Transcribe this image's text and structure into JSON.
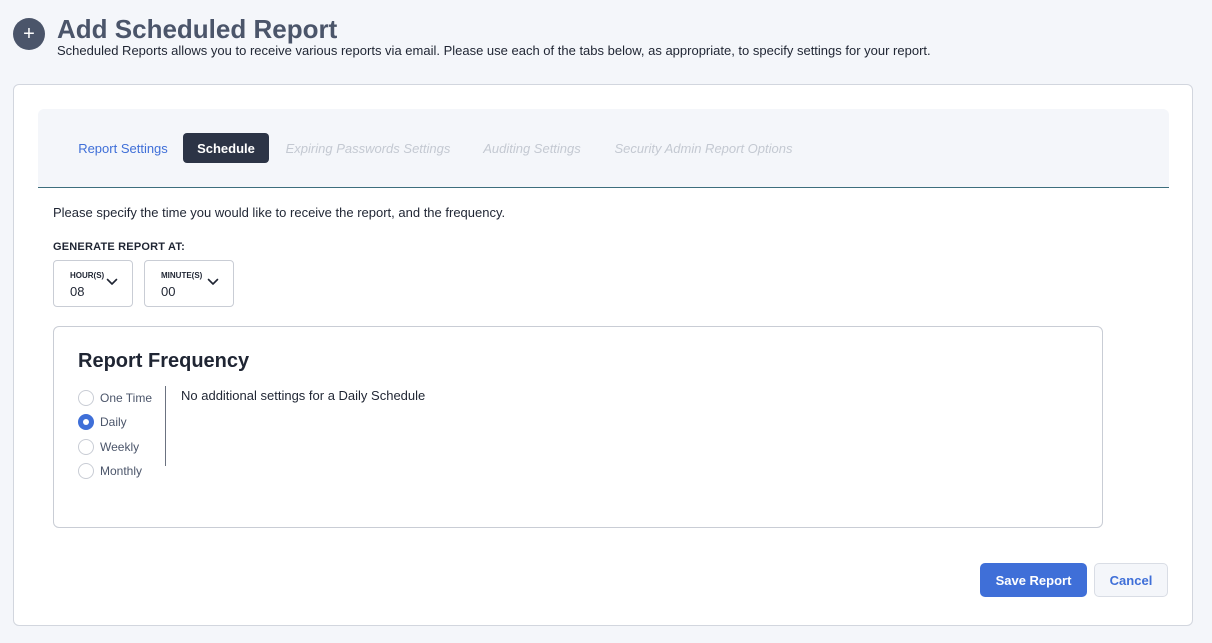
{
  "header": {
    "icon": "plus-icon",
    "icon_glyph": "+",
    "title": "Add Scheduled Report",
    "subtitle": "Scheduled Reports allows you to receive various reports via email. Please use each of the tabs below, as appropriate, to specify settings for your report."
  },
  "tabs": [
    {
      "label": "Report Settings",
      "state": "link"
    },
    {
      "label": "Schedule",
      "state": "active"
    },
    {
      "label": "Expiring Passwords Settings",
      "state": "disabled"
    },
    {
      "label": "Auditing Settings",
      "state": "disabled"
    },
    {
      "label": "Security Admin Report Options",
      "state": "disabled"
    }
  ],
  "schedule": {
    "instructions": "Please specify the time you would like to receive the report, and the frequency.",
    "generate_label": "GENERATE REPORT AT:",
    "hour": {
      "label": "HOUR(S)",
      "value": "08"
    },
    "minute": {
      "label": "MINUTE(S)",
      "value": "00"
    }
  },
  "frequency": {
    "title": "Report Frequency",
    "options": [
      {
        "label": "One Time",
        "checked": false
      },
      {
        "label": "Daily",
        "checked": true
      },
      {
        "label": "Weekly",
        "checked": false
      },
      {
        "label": "Monthly",
        "checked": false
      }
    ],
    "note": "No additional settings for a Daily Schedule"
  },
  "actions": {
    "save_label": "Save Report",
    "cancel_label": "Cancel"
  },
  "colors": {
    "accent": "#3f6fd8",
    "active_tab": "#2c3446",
    "header_text": "#4b556a",
    "disabled_tab": "#c4c9d2"
  }
}
